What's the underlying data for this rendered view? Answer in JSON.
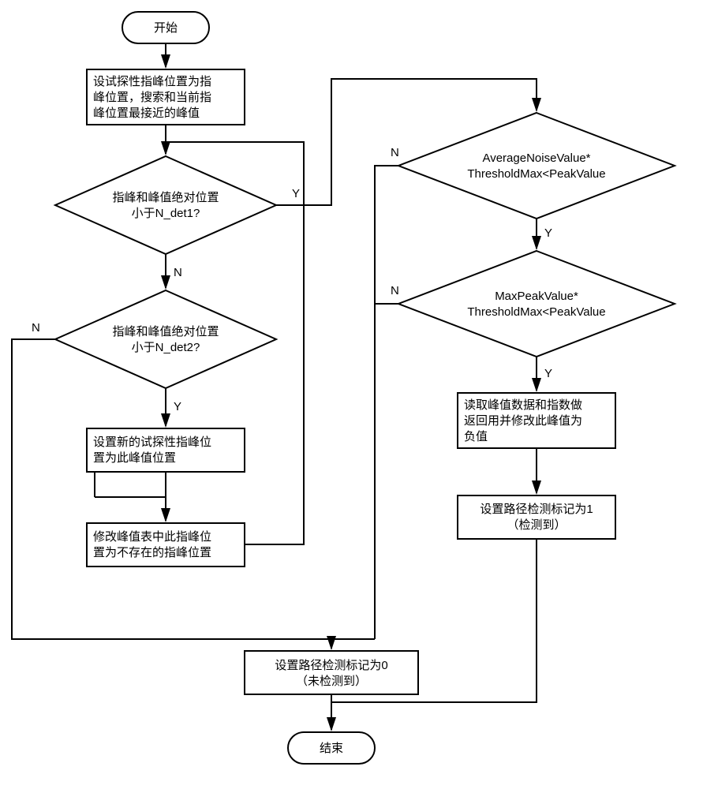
{
  "terminals": {
    "start": "开始",
    "end": "结束"
  },
  "processes": {
    "p1_line1": "设试探性指峰位置为指",
    "p1_line2": "峰位置，搜索和当前指",
    "p1_line3": "峰位置最接近的峰值",
    "p2_line1": "设置新的试探性指峰位",
    "p2_line2": "置为此峰值位置",
    "p3_line1": "修改峰值表中此指峰位",
    "p3_line2": "置为不存在的指峰位置",
    "p4_line1": "读取峰值数据和指数做",
    "p4_line2": "返回用并修改此峰值为",
    "p4_line3": "负值",
    "p5_line1": "设置路径检测标记为1",
    "p5_line2": "（检测到）",
    "p6_line1": "设置路径检测标记为0",
    "p6_line2": "（未检测到）"
  },
  "decisions": {
    "d1_line1": "指峰和峰值绝对位置",
    "d1_line2": "小于N_det1?",
    "d2_line1": "指峰和峰值绝对位置",
    "d2_line2": "小于N_det2?",
    "d3_line1": "AverageNoiseValue*",
    "d3_line2": "ThresholdMax<PeakValue",
    "d4_line1": "MaxPeakValue*",
    "d4_line2": "ThresholdMax<PeakValue"
  },
  "labels": {
    "yes": "Y",
    "no": "N"
  }
}
